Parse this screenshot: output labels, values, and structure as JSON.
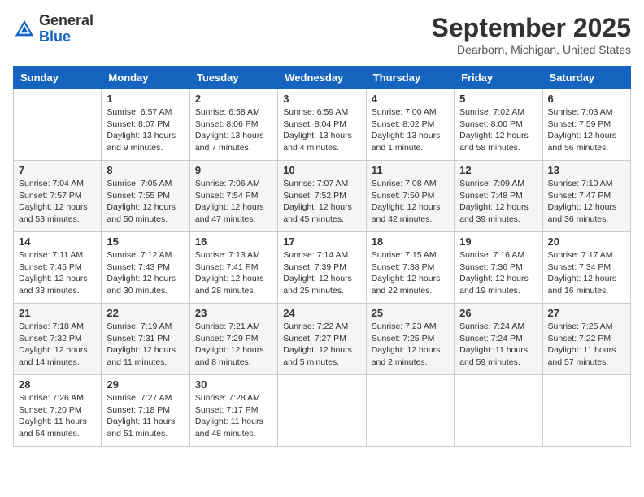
{
  "header": {
    "logo_general": "General",
    "logo_blue": "Blue",
    "month_title": "September 2025",
    "location": "Dearborn, Michigan, United States"
  },
  "weekdays": [
    "Sunday",
    "Monday",
    "Tuesday",
    "Wednesday",
    "Thursday",
    "Friday",
    "Saturday"
  ],
  "weeks": [
    [
      {
        "day": "",
        "info": ""
      },
      {
        "day": "1",
        "info": "Sunrise: 6:57 AM\nSunset: 8:07 PM\nDaylight: 13 hours\nand 9 minutes."
      },
      {
        "day": "2",
        "info": "Sunrise: 6:58 AM\nSunset: 8:06 PM\nDaylight: 13 hours\nand 7 minutes."
      },
      {
        "day": "3",
        "info": "Sunrise: 6:59 AM\nSunset: 8:04 PM\nDaylight: 13 hours\nand 4 minutes."
      },
      {
        "day": "4",
        "info": "Sunrise: 7:00 AM\nSunset: 8:02 PM\nDaylight: 13 hours\nand 1 minute."
      },
      {
        "day": "5",
        "info": "Sunrise: 7:02 AM\nSunset: 8:00 PM\nDaylight: 12 hours\nand 58 minutes."
      },
      {
        "day": "6",
        "info": "Sunrise: 7:03 AM\nSunset: 7:59 PM\nDaylight: 12 hours\nand 56 minutes."
      }
    ],
    [
      {
        "day": "7",
        "info": "Sunrise: 7:04 AM\nSunset: 7:57 PM\nDaylight: 12 hours\nand 53 minutes."
      },
      {
        "day": "8",
        "info": "Sunrise: 7:05 AM\nSunset: 7:55 PM\nDaylight: 12 hours\nand 50 minutes."
      },
      {
        "day": "9",
        "info": "Sunrise: 7:06 AM\nSunset: 7:54 PM\nDaylight: 12 hours\nand 47 minutes."
      },
      {
        "day": "10",
        "info": "Sunrise: 7:07 AM\nSunset: 7:52 PM\nDaylight: 12 hours\nand 45 minutes."
      },
      {
        "day": "11",
        "info": "Sunrise: 7:08 AM\nSunset: 7:50 PM\nDaylight: 12 hours\nand 42 minutes."
      },
      {
        "day": "12",
        "info": "Sunrise: 7:09 AM\nSunset: 7:48 PM\nDaylight: 12 hours\nand 39 minutes."
      },
      {
        "day": "13",
        "info": "Sunrise: 7:10 AM\nSunset: 7:47 PM\nDaylight: 12 hours\nand 36 minutes."
      }
    ],
    [
      {
        "day": "14",
        "info": "Sunrise: 7:11 AM\nSunset: 7:45 PM\nDaylight: 12 hours\nand 33 minutes."
      },
      {
        "day": "15",
        "info": "Sunrise: 7:12 AM\nSunset: 7:43 PM\nDaylight: 12 hours\nand 30 minutes."
      },
      {
        "day": "16",
        "info": "Sunrise: 7:13 AM\nSunset: 7:41 PM\nDaylight: 12 hours\nand 28 minutes."
      },
      {
        "day": "17",
        "info": "Sunrise: 7:14 AM\nSunset: 7:39 PM\nDaylight: 12 hours\nand 25 minutes."
      },
      {
        "day": "18",
        "info": "Sunrise: 7:15 AM\nSunset: 7:38 PM\nDaylight: 12 hours\nand 22 minutes."
      },
      {
        "day": "19",
        "info": "Sunrise: 7:16 AM\nSunset: 7:36 PM\nDaylight: 12 hours\nand 19 minutes."
      },
      {
        "day": "20",
        "info": "Sunrise: 7:17 AM\nSunset: 7:34 PM\nDaylight: 12 hours\nand 16 minutes."
      }
    ],
    [
      {
        "day": "21",
        "info": "Sunrise: 7:18 AM\nSunset: 7:32 PM\nDaylight: 12 hours\nand 14 minutes."
      },
      {
        "day": "22",
        "info": "Sunrise: 7:19 AM\nSunset: 7:31 PM\nDaylight: 12 hours\nand 11 minutes."
      },
      {
        "day": "23",
        "info": "Sunrise: 7:21 AM\nSunset: 7:29 PM\nDaylight: 12 hours\nand 8 minutes."
      },
      {
        "day": "24",
        "info": "Sunrise: 7:22 AM\nSunset: 7:27 PM\nDaylight: 12 hours\nand 5 minutes."
      },
      {
        "day": "25",
        "info": "Sunrise: 7:23 AM\nSunset: 7:25 PM\nDaylight: 12 hours\nand 2 minutes."
      },
      {
        "day": "26",
        "info": "Sunrise: 7:24 AM\nSunset: 7:24 PM\nDaylight: 11 hours\nand 59 minutes."
      },
      {
        "day": "27",
        "info": "Sunrise: 7:25 AM\nSunset: 7:22 PM\nDaylight: 11 hours\nand 57 minutes."
      }
    ],
    [
      {
        "day": "28",
        "info": "Sunrise: 7:26 AM\nSunset: 7:20 PM\nDaylight: 11 hours\nand 54 minutes."
      },
      {
        "day": "29",
        "info": "Sunrise: 7:27 AM\nSunset: 7:18 PM\nDaylight: 11 hours\nand 51 minutes."
      },
      {
        "day": "30",
        "info": "Sunrise: 7:28 AM\nSunset: 7:17 PM\nDaylight: 11 hours\nand 48 minutes."
      },
      {
        "day": "",
        "info": ""
      },
      {
        "day": "",
        "info": ""
      },
      {
        "day": "",
        "info": ""
      },
      {
        "day": "",
        "info": ""
      }
    ]
  ]
}
